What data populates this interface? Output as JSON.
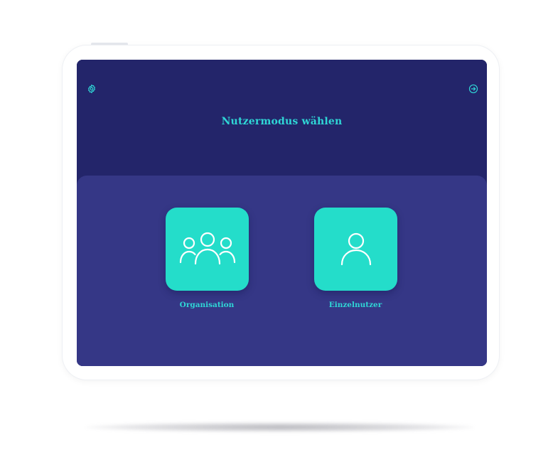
{
  "header": {
    "title": "Nutzermodus wählen",
    "settings_icon": "gear-icon",
    "logout_icon": "logout-icon"
  },
  "modes": [
    {
      "label": "Organisation",
      "icon": "group-icon"
    },
    {
      "label": "Einzelnutzer",
      "icon": "user-icon"
    }
  ],
  "colors": {
    "header_bg": "#23256a",
    "panel_bg": "#353786",
    "tile_bg": "#24ddca",
    "accent_text": "#2fd6d6",
    "icon_stroke": "#ffffff"
  }
}
